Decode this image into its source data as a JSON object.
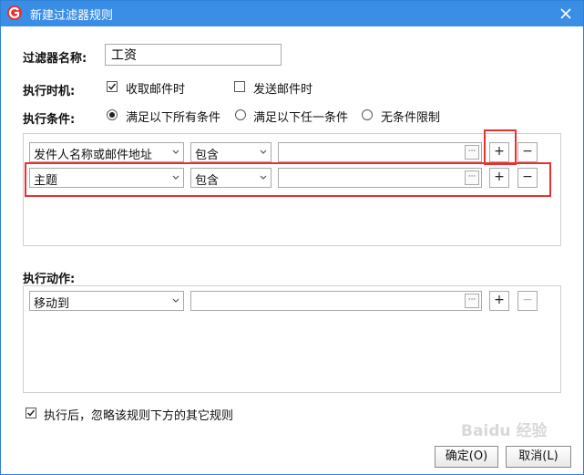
{
  "window": {
    "title": "新建过滤器规则",
    "colors": {
      "titlebar": "#3a8ee6",
      "highlight": "#e8312f"
    }
  },
  "form": {
    "name_label": "过滤器名称:",
    "name_value": "工资",
    "timing_label": "执行时机:",
    "timing_options": [
      {
        "label": "收取邮件时",
        "checked": true
      },
      {
        "label": "发送邮件时",
        "checked": false
      }
    ],
    "condition_label": "执行条件:",
    "condition_options": [
      {
        "label": "满足以下所有条件",
        "selected": true
      },
      {
        "label": "满足以下任一条件",
        "selected": false
      },
      {
        "label": "无条件限制",
        "selected": false
      }
    ]
  },
  "conditions": [
    {
      "field": "发件人名称或邮件地址",
      "operator": "包含",
      "value": ""
    },
    {
      "field": "主题",
      "operator": "包含",
      "value": ""
    }
  ],
  "actions_label": "执行动作:",
  "actions": [
    {
      "action": "移动到",
      "value": ""
    }
  ],
  "ignore_rules": {
    "label": "执行后，忽略该规则下方的其它规则",
    "checked": true
  },
  "buttons": {
    "ellipsis": "···",
    "add": "+",
    "remove": "−",
    "ok": "确定(O)",
    "cancel": "取消(L)"
  },
  "watermark_text": "Baidu 经验"
}
